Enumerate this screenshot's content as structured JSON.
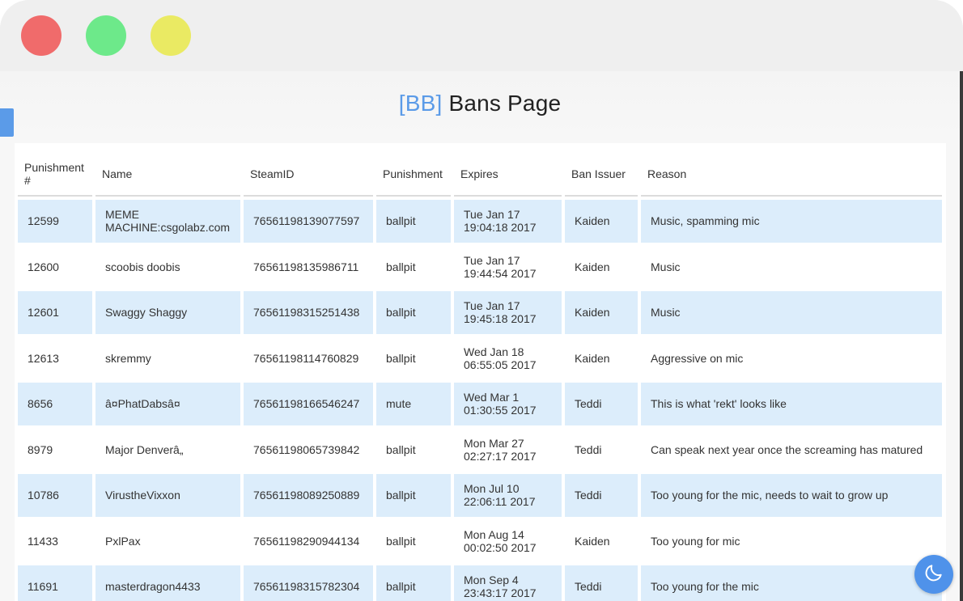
{
  "title": {
    "accent": "[BB]",
    "text": " Bans Page"
  },
  "columns": [
    "Punishment #",
    "Name",
    "SteamID",
    "Punishment",
    "Expires",
    "Ban Issuer",
    "Reason"
  ],
  "rows": [
    {
      "id": "12599",
      "name": "MEME MACHINE:csgolabz.com",
      "steamid": "76561198139077597",
      "punishment": "ballpit",
      "expires": "Tue Jan 17 19:04:18 2017",
      "issuer": "Kaiden",
      "reason": "Music, spamming mic"
    },
    {
      "id": "12600",
      "name": "scoobis doobis",
      "steamid": "76561198135986711",
      "punishment": "ballpit",
      "expires": "Tue Jan 17 19:44:54 2017",
      "issuer": "Kaiden",
      "reason": "Music"
    },
    {
      "id": "12601",
      "name": "Swaggy Shaggy",
      "steamid": "76561198315251438",
      "punishment": "ballpit",
      "expires": "Tue Jan 17 19:45:18 2017",
      "issuer": "Kaiden",
      "reason": "Music"
    },
    {
      "id": "12613",
      "name": "skremmy",
      "steamid": "76561198114760829",
      "punishment": "ballpit",
      "expires": "Wed Jan 18 06:55:05 2017",
      "issuer": "Kaiden",
      "reason": "Aggressive on mic"
    },
    {
      "id": "8656",
      "name": "â¤PhatDabsâ¤",
      "steamid": "76561198166546247",
      "punishment": "mute",
      "expires": "Wed Mar 1 01:30:55 2017",
      "issuer": "Teddi",
      "reason": "This is what 'rekt' looks like"
    },
    {
      "id": "8979",
      "name": "Major Denverâ„",
      "steamid": "76561198065739842",
      "punishment": "ballpit",
      "expires": "Mon Mar 27 02:27:17 2017",
      "issuer": "Teddi",
      "reason": "Can speak next year once the screaming has matured"
    },
    {
      "id": "10786",
      "name": "VirustheVixxon",
      "steamid": "76561198089250889",
      "punishment": "ballpit",
      "expires": "Mon Jul 10 22:06:11 2017",
      "issuer": "Teddi",
      "reason": "Too young for the mic, needs to wait to grow up"
    },
    {
      "id": "11433",
      "name": "PxlPax",
      "steamid": "76561198290944134",
      "punishment": "ballpit",
      "expires": "Mon Aug 14 00:02:50 2017",
      "issuer": "Kaiden",
      "reason": "Too young for mic"
    },
    {
      "id": "11691",
      "name": "masterdragon4433",
      "steamid": "76561198315782304",
      "punishment": "ballpit",
      "expires": "Mon Sep 4 23:43:17 2017",
      "issuer": "Teddi",
      "reason": "Too young for the mic"
    }
  ],
  "theme_toggle": {
    "icon": "moon-icon"
  },
  "colors": {
    "accent": "#5b9be8",
    "row_shade": "#dcedfb",
    "close": "#f06b6b",
    "maximize": "#6de98a",
    "minimize": "#eaea63"
  }
}
